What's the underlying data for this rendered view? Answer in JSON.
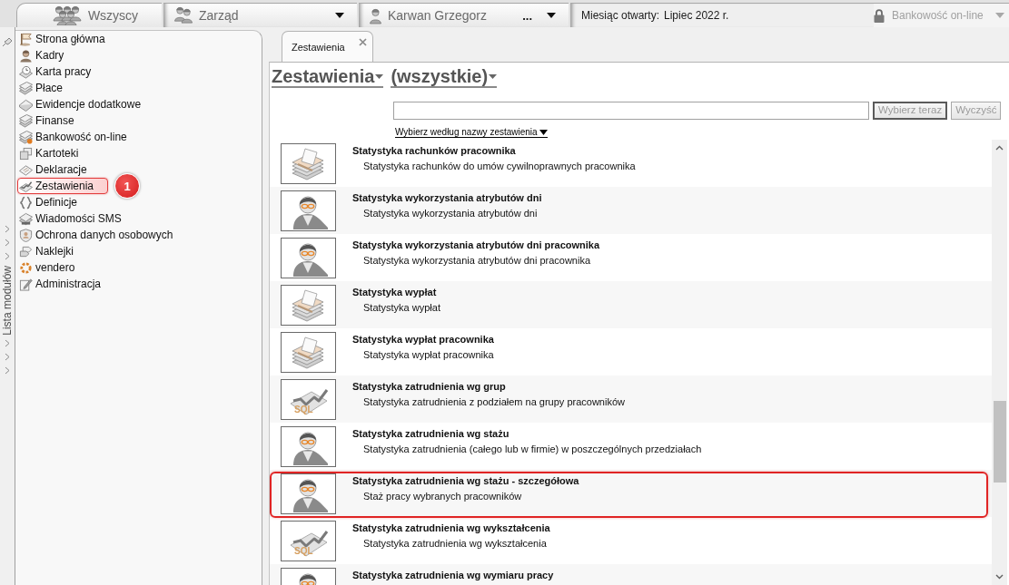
{
  "top_bar": {
    "filters": [
      {
        "kind": "group",
        "label": "Wszyscy",
        "dropdown": false
      },
      {
        "kind": "team",
        "label": "Zarząd",
        "dropdown": true
      },
      {
        "kind": "person",
        "label": "Karwan Grzegorz",
        "more_button": "...",
        "dropdown": true
      }
    ],
    "open_month": {
      "label": "Miesiąc otwarty:",
      "value": "Lipiec 2022 r."
    },
    "banking_button": {
      "label": "Bankowość on-line",
      "disabled": true,
      "dropdown": true
    }
  },
  "sidebar": {
    "title": "Lista modułów",
    "modules": [
      {
        "kind": "flag",
        "label": "Strona główna",
        "highlighted": false
      },
      {
        "kind": "person",
        "label": "Kadry",
        "highlighted": false
      },
      {
        "kind": "clock",
        "label": "Karta pracy",
        "highlighted": false
      },
      {
        "kind": "notes",
        "label": "Płace",
        "highlighted": false
      },
      {
        "kind": "book",
        "label": "Ewidencje dodatkowe",
        "highlighted": false
      },
      {
        "kind": "notes",
        "label": "Finanse",
        "highlighted": false
      },
      {
        "kind": "banking",
        "label": "Bankowość on-line",
        "highlighted": false
      },
      {
        "kind": "cards",
        "label": "Kartoteki",
        "highlighted": false
      },
      {
        "kind": "form",
        "label": "Deklaracje",
        "highlighted": false
      },
      {
        "kind": "chart",
        "label": "Zestawienia",
        "highlighted": true,
        "callout": "1"
      },
      {
        "kind": "braces",
        "label": "Definicje",
        "highlighted": false
      },
      {
        "kind": "sms",
        "label": "Wiadomości SMS",
        "highlighted": false
      },
      {
        "kind": "shield",
        "label": "Ochrona danych osobowych",
        "highlighted": false
      },
      {
        "kind": "labels",
        "label": "Naklejki",
        "highlighted": false
      },
      {
        "kind": "ring",
        "label": "vendero",
        "highlighted": false
      },
      {
        "kind": "edit",
        "label": "Administracja",
        "highlighted": false
      }
    ]
  },
  "document_tabs": [
    {
      "label": "Zestawienia",
      "selected": true,
      "closable": true
    }
  ],
  "heading": {
    "category": "Zestawienia",
    "filter": "(wszystkie)"
  },
  "search": {
    "buttons": [
      {
        "label": "Wybierz teraz",
        "disabled": true,
        "default": true
      },
      {
        "label": "Wyczyść",
        "disabled": true,
        "default": false
      }
    ],
    "mode_link": "Wybierz według nazwy zestawienia"
  },
  "reports": [
    {
      "kind": "money",
      "title": "Statystyka rachunków pracownika",
      "description": "Statystyka rachunków do umów cywilnoprawnych pracownika",
      "highlighted": false
    },
    {
      "kind": "person",
      "title": "Statystyka wykorzystania atrybutów dni",
      "description": "Statystyka wykorzystania atrybutów dni",
      "highlighted": false
    },
    {
      "kind": "person",
      "title": "Statystyka wykorzystania atrybutów dni pracownika",
      "description": "Statystyka wykorzystania atrybutów dni pracownika",
      "highlighted": false
    },
    {
      "kind": "money",
      "title": "Statystyka wypłat",
      "description": "Statystyka wypłat",
      "highlighted": false
    },
    {
      "kind": "money",
      "title": "Statystyka wypłat pracownika",
      "description": "Statystyka wypłat pracownika",
      "highlighted": false
    },
    {
      "kind": "sql_chart",
      "icon_label": "SQL",
      "title": "Statystyka zatrudnienia wg grup",
      "description": "Statystyka zatrudnienia z podziałem na grupy pracowników",
      "highlighted": false
    },
    {
      "kind": "person",
      "title": "Statystyka zatrudnienia wg stażu",
      "description": "Statystyka zatrudnienia (całego lub w firmie) w poszczególnych przedziałach",
      "highlighted": false
    },
    {
      "kind": "person",
      "title": "Statystyka zatrudnienia wg stażu - szczegółowa",
      "description": "Staż pracy wybranych pracowników",
      "highlighted": true
    },
    {
      "kind": "sql_chart",
      "icon_label": "SQL",
      "title": "Statystyka zatrudnienia wg wykształcenia",
      "description": "Statystyka zatrudnienia wg wykształcenia",
      "highlighted": false
    },
    {
      "kind": "person",
      "title": "Statystyka zatrudnienia wg wymiaru pracy",
      "highlighted": false
    }
  ]
}
